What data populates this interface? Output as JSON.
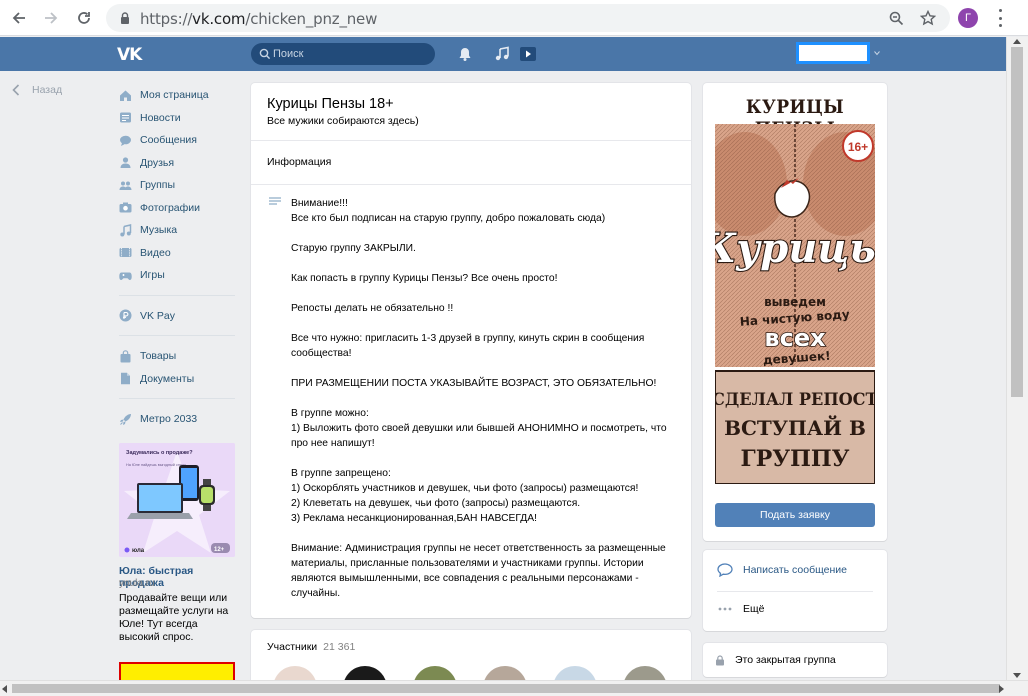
{
  "browser": {
    "url_scheme": "https://",
    "url_host": "vk.com",
    "url_path": "/chicken_pnz_new",
    "profile_letter": "Г"
  },
  "header": {
    "logo": "VK",
    "search_placeholder": "Поиск"
  },
  "sidebar": {
    "back_label": "Назад",
    "items": [
      {
        "label": "Моя страница",
        "icon": "home-icon"
      },
      {
        "label": "Новости",
        "icon": "news-icon"
      },
      {
        "label": "Сообщения",
        "icon": "messages-icon"
      },
      {
        "label": "Друзья",
        "icon": "friends-icon"
      },
      {
        "label": "Группы",
        "icon": "groups-icon"
      },
      {
        "label": "Фотографии",
        "icon": "camera-icon"
      },
      {
        "label": "Музыка",
        "icon": "music-icon"
      },
      {
        "label": "Видео",
        "icon": "video-icon"
      },
      {
        "label": "Игры",
        "icon": "gamepad-icon"
      },
      {
        "label": "VK Pay",
        "icon": "vkpay-icon"
      },
      {
        "label": "Товары",
        "icon": "bag-icon"
      },
      {
        "label": "Документы",
        "icon": "document-icon"
      },
      {
        "label": "Метро 2033",
        "icon": "rocket-icon"
      }
    ],
    "ad": {
      "banner_heading": "Задумались о продаже?",
      "banner_sub": "На Юле найдешь выгодный спрос",
      "banner_brand": "юла",
      "banner_age": "12+",
      "title": "Юла: быстрая продажа",
      "domain": "youla.ru",
      "text": "Продавайте вещи или размещайте услуги на Юле! Тут всегда высокий спрос."
    }
  },
  "group": {
    "name": "Курицы Пензы 18+",
    "status": "Все мужики собираются здесь)",
    "info_title": "Информация",
    "description": [
      "Внимание!!!",
      "Все кто был подписан на старую группу, добро пожаловать сюда)",
      "",
      "Старую группу ЗАКРЫЛИ.",
      "",
      "Как попасть в группу Курицы Пензы? Все очень просто!",
      "",
      "Репосты делать не обязательно !!",
      "",
      "Все что нужно: пригласить 1-3 друзей в группу, кинуть скрин в сообщения сообщества!",
      "",
      "ПРИ РАЗМЕЩЕНИИ ПОСТА УКАЗЫВАЙТЕ ВОЗРАСТ, ЭТО ОБЯЗАТЕЛЬНО!",
      "",
      "В группе можно:",
      "1) Выложить фото своей девушки или бывшей АНОНИМНО и посмотреть, что про нее напишут!",
      "",
      "В группе запрещено:",
      "1) Оскорблять участников и девушек, чьи фото (запросы) размещаются!",
      "2) Клеветать на девушек, чьи фото (запросы) размещаются.",
      "3) Реклама несанкционированная,БАН НАВСЕГДА!",
      "",
      "Внимание: Администрация группы не несет ответственность за размещенные материалы, присланные пользователями и участниками группы. Истории являются вымышленными, все совпадения с реальными персонажами - случайны."
    ],
    "members_label": "Участники",
    "members_count": "21 361"
  },
  "cover": {
    "title": "КУРИЦЫ ПЕНЗЫ",
    "age_badge": "16+",
    "word_main": "Курицы",
    "slogan_line1": "выведем",
    "slogan_line2": "На чистую воду",
    "slogan_line3": "всех",
    "slogan_line4": "девушек!",
    "bottom_line1": "СДЕЛАЛ РЕПОСТ",
    "bottom_line2": "ВСТУПАЙ В",
    "bottom_line3": "ГРУППУ"
  },
  "actions": {
    "apply_label": "Подать заявку",
    "message_label": "Написать сообщение",
    "more_label": "Ещё",
    "closed_label": "Это закрытая группа"
  },
  "colors": {
    "vk_blue": "#4a76a8",
    "link": "#2a5885",
    "button": "#5181b8",
    "page_bg": "#edeef0"
  }
}
